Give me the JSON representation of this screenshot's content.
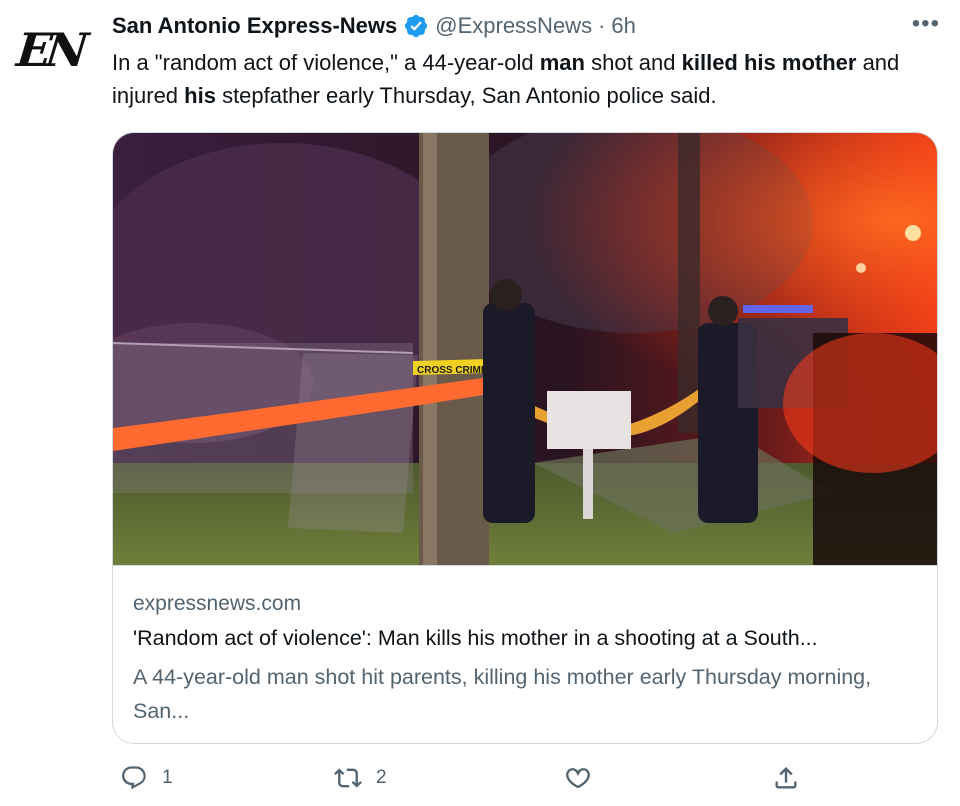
{
  "author": {
    "avatar_text": "EN",
    "name": "San Antonio Express-News",
    "verified_icon": "verified-badge-icon",
    "handle": "@ExpressNews",
    "separator": "·",
    "time": "6h",
    "more_icon": "more-horizontal-icon"
  },
  "tweet": {
    "segments": [
      {
        "text": "In a \"random act of violence,\" a 44-year-old ",
        "bold": false
      },
      {
        "text": "man",
        "bold": true
      },
      {
        "text": " shot and ",
        "bold": false
      },
      {
        "text": "killed his mother",
        "bold": true
      },
      {
        "text": " and injured ",
        "bold": false
      },
      {
        "text": "his",
        "bold": true
      },
      {
        "text": " stepfather early Thursday, San Antonio police said.",
        "bold": false
      }
    ]
  },
  "card": {
    "image_text": "CROSS CRIME",
    "domain": "expressnews.com",
    "title": "'Random act of violence': Man kills his mother in a shooting at a South...",
    "description": "A 44-year-old man shot hit parents, killing his mother early Thursday morning, San..."
  },
  "actions": {
    "reply": {
      "icon": "reply-icon",
      "count": "1"
    },
    "retweet": {
      "icon": "retweet-icon",
      "count": "2"
    },
    "like": {
      "icon": "like-icon",
      "count": ""
    },
    "share": {
      "icon": "share-icon",
      "count": ""
    }
  },
  "colors": {
    "text": "#0f1419",
    "secondary": "#536471",
    "verified": "#1d9bf0",
    "border": "#cfd9de"
  }
}
